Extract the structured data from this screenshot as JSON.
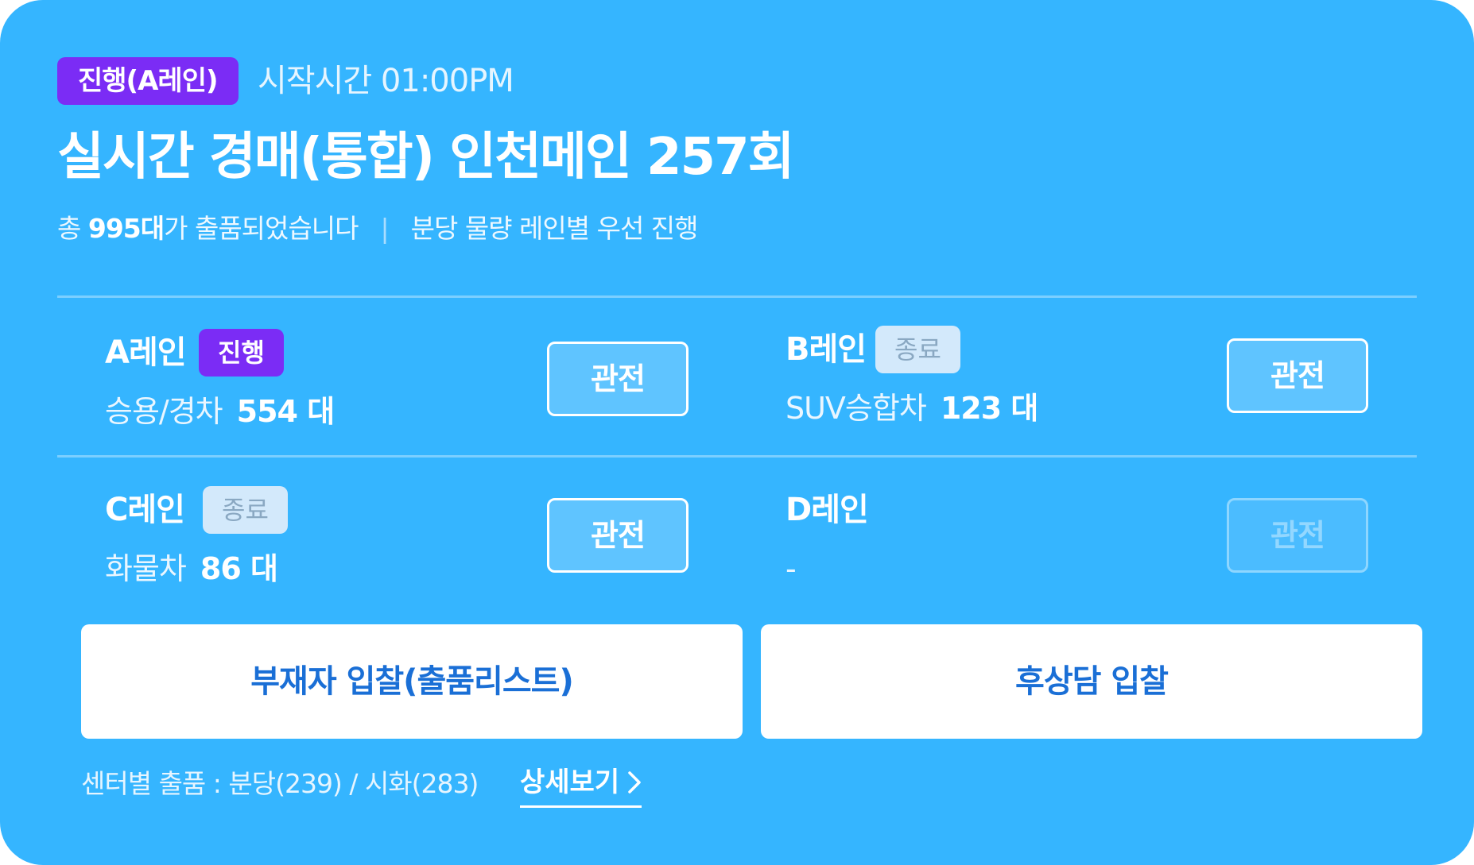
{
  "header": {
    "live_badge": "진행(A레인)",
    "start_time": "시작시간 01:00PM",
    "title": "실시간 경매(통합) 인천메인 257회",
    "summary_prefix": "총 ",
    "summary_count": "995대",
    "summary_suffix": "가 출품되었습니다",
    "summary_separator": "|",
    "summary_note": "분당 물량 레인별 우선 진행"
  },
  "lanes": [
    {
      "name": "A레인",
      "status": "진행",
      "category": "승용/경차",
      "count": "554 대",
      "watch_label": "관전",
      "watch_enabled": true
    },
    {
      "name": "B레인",
      "status": "종료",
      "category": "SUV승합차",
      "count": "123 대",
      "watch_label": "관전",
      "watch_enabled": true
    },
    {
      "name": "C레인",
      "status": "종료",
      "category": "화물차",
      "count": "86 대",
      "watch_label": "관전",
      "watch_enabled": true
    },
    {
      "name": "D레인",
      "status": "",
      "category": "-",
      "count": "",
      "watch_label": "관전",
      "watch_enabled": false
    }
  ],
  "actions": {
    "absentee_bid": "부재자 입찰(출품리스트)",
    "post_negotiation_bid": "후상담 입찰"
  },
  "footer": {
    "center_listing": "센터별 출품 : 분당(239) / 시화(283)",
    "detail_link": "상세보기",
    "detail_icon": "chevron-right-icon"
  },
  "colors": {
    "card_background": "#35b5ff",
    "live_badge": "#7b2cf5",
    "done_badge": "#d3e9fb",
    "action_text": "#1a6fd6"
  }
}
